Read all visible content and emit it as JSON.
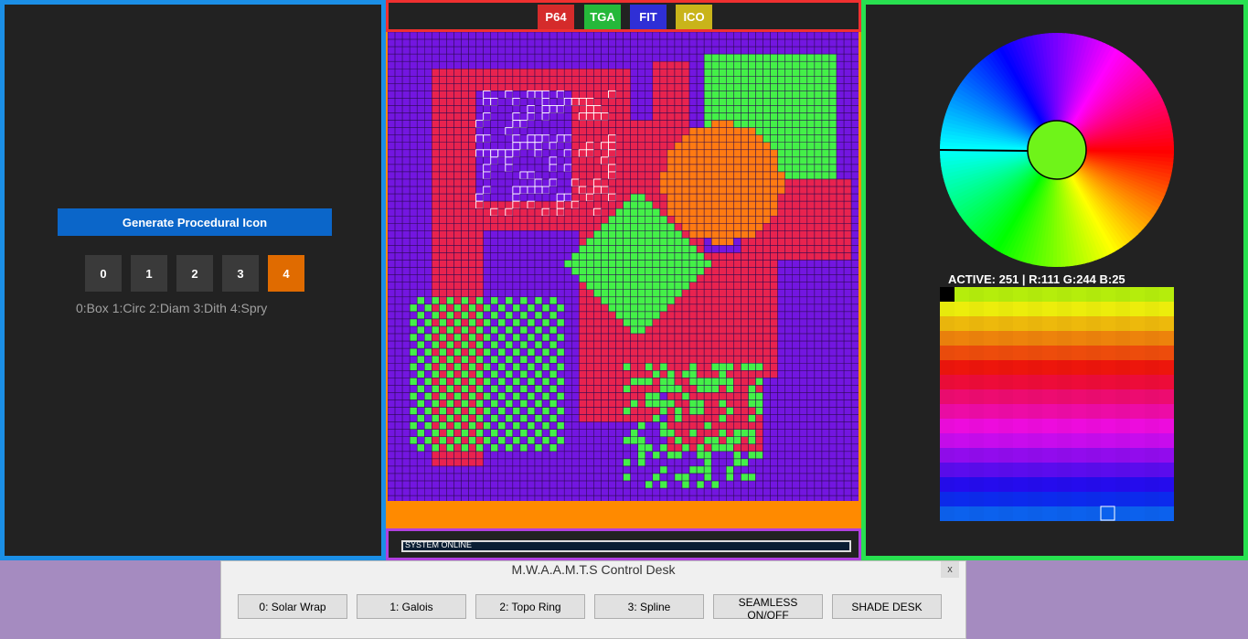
{
  "left": {
    "generate_label": "Generate Procedural Icon",
    "shape_buttons": [
      "0",
      "1",
      "2",
      "3",
      "4"
    ],
    "active_shape": 4,
    "legend": "0:Box 1:Circ 2:Diam 3:Dith 4:Spry"
  },
  "center": {
    "formats": [
      {
        "label": "P64",
        "color": "#d52b2b"
      },
      {
        "label": "TGA",
        "color": "#25b83a"
      },
      {
        "label": "FIT",
        "color": "#2f2fd6"
      },
      {
        "label": "ICO",
        "color": "#c9b41a"
      }
    ],
    "status": "SYSTEM ONLINE",
    "colors": {
      "background": "#7316e0",
      "crimson": "#e8234f",
      "green": "#44f048",
      "orange": "#ff7a12"
    }
  },
  "right": {
    "active_label": "ACTIVE: 251 | R:111 G:244 B:25",
    "active_color": "#6ff419"
  },
  "dialog": {
    "title": "M.W.A.A.M.T.S Control Desk",
    "close": "x",
    "buttons": [
      "0: Solar Wrap",
      "1: Galois",
      "2: Topo Ring",
      "3: Spline",
      "SEAMLESS ON/OFF",
      "SHADE DESK"
    ]
  }
}
